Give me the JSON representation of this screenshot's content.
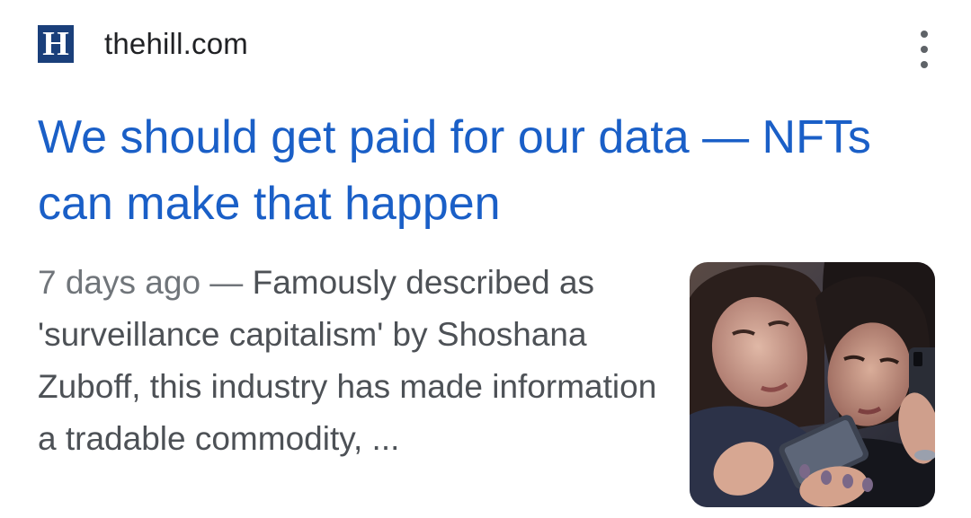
{
  "result": {
    "source": {
      "favicon_letter": "H",
      "domain": "thehill.com"
    },
    "menu": {
      "icon": "more-vert-icon"
    },
    "title": "We should get paid for our data — NFTs can make that happen",
    "snippet": {
      "age": "7 days ago",
      "separator": " — ",
      "text": "Famously described as 'surveillance capitalism' by Shoshana Zuboff, this industry has made information a tradable commodity, ..."
    },
    "thumbnail": {
      "icon": "news-thumbnail-image"
    }
  },
  "colors": {
    "title_link": "#1a5fc7",
    "favicon": "#1a3f7a",
    "snippet_text": "#4d5156",
    "age_text": "#70757a"
  }
}
